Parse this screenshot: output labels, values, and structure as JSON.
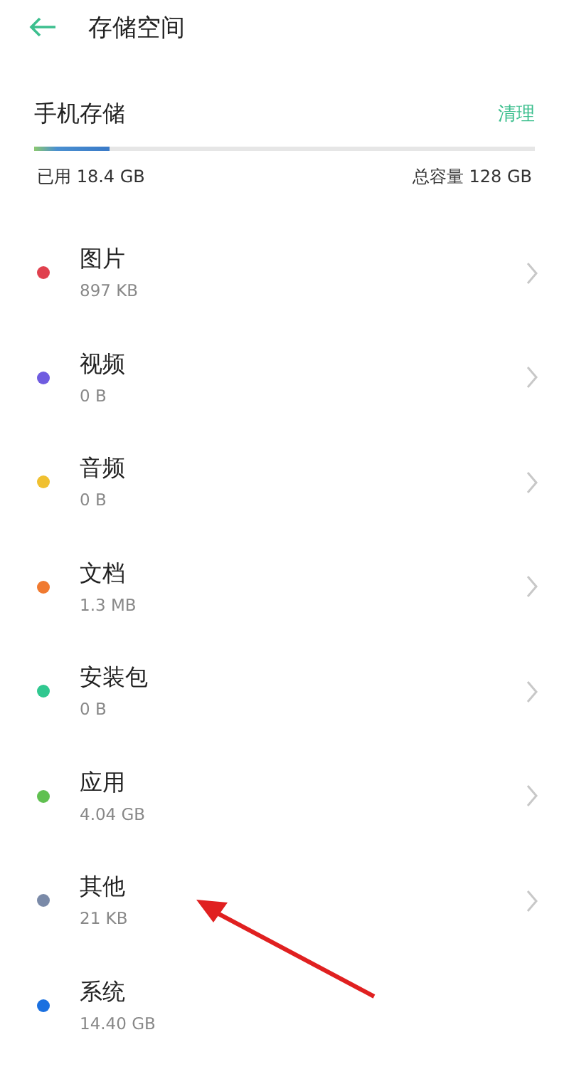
{
  "header": {
    "title": "存储空间"
  },
  "storage": {
    "title": "手机存储",
    "action": "清理",
    "level": 0.15,
    "used": "已用 18.4  GB",
    "total": "总容量 128 GB"
  },
  "categories": [
    {
      "name": "图片",
      "size": "897 KB",
      "color": "#e0404e",
      "chevron": true
    },
    {
      "name": "视频",
      "size": "0 B",
      "color": "#6f5ce0",
      "chevron": true
    },
    {
      "name": "音频",
      "size": "0 B",
      "color": "#f0c030",
      "chevron": true
    },
    {
      "name": "文档",
      "size": "1.3 MB",
      "color": "#f07a30",
      "chevron": true
    },
    {
      "name": "安装包",
      "size": "0 B",
      "color": "#30c890",
      "chevron": true
    },
    {
      "name": "应用",
      "size": "4.04 GB",
      "color": "#60c050",
      "chevron": true
    },
    {
      "name": "其他",
      "size": "21 KB",
      "color": "#7a8aa8",
      "chevron": true
    },
    {
      "name": "系统",
      "size": "14.40  GB",
      "color": "#1a70e0",
      "chevron": false
    }
  ]
}
